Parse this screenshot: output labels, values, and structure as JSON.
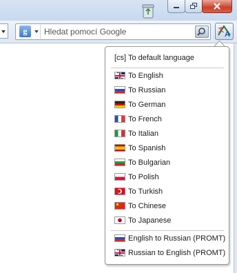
{
  "search": {
    "placeholder": "Hledat pomocí Google",
    "engine_icon": "google-g-icon",
    "go_icon": "magnifier-icon"
  },
  "toolbar": {
    "translate_icon": "translate-icon",
    "recycle_icon": "recycle-bin-icon"
  },
  "menu": {
    "default_item": "[cs] To default language",
    "languages": [
      {
        "label": "To English",
        "flag": "gb-flag-icon"
      },
      {
        "label": "To Russian",
        "flag": "ru-flag-icon"
      },
      {
        "label": "To German",
        "flag": "de-flag-icon"
      },
      {
        "label": "To French",
        "flag": "fr-flag-icon"
      },
      {
        "label": "To Italian",
        "flag": "it-flag-icon"
      },
      {
        "label": "To Spanish",
        "flag": "es-flag-icon"
      },
      {
        "label": "To Bulgarian",
        "flag": "bg-flag-icon"
      },
      {
        "label": "To Polish",
        "flag": "pl-flag-icon"
      },
      {
        "label": "To Turkish",
        "flag": "tr-flag-icon"
      },
      {
        "label": "To Chinese",
        "flag": "cn-flag-icon"
      },
      {
        "label": "To Japanese",
        "flag": "jp-flag-icon"
      }
    ],
    "promt": [
      {
        "label": "English to Russian (PROMT)",
        "flag": "ru-flag-icon"
      },
      {
        "label": "Russian to English (PROMT)",
        "flag": "gb-flag-icon"
      }
    ]
  },
  "colors": {
    "close_button": "#c9412c",
    "chrome": "#dfe7f1"
  }
}
